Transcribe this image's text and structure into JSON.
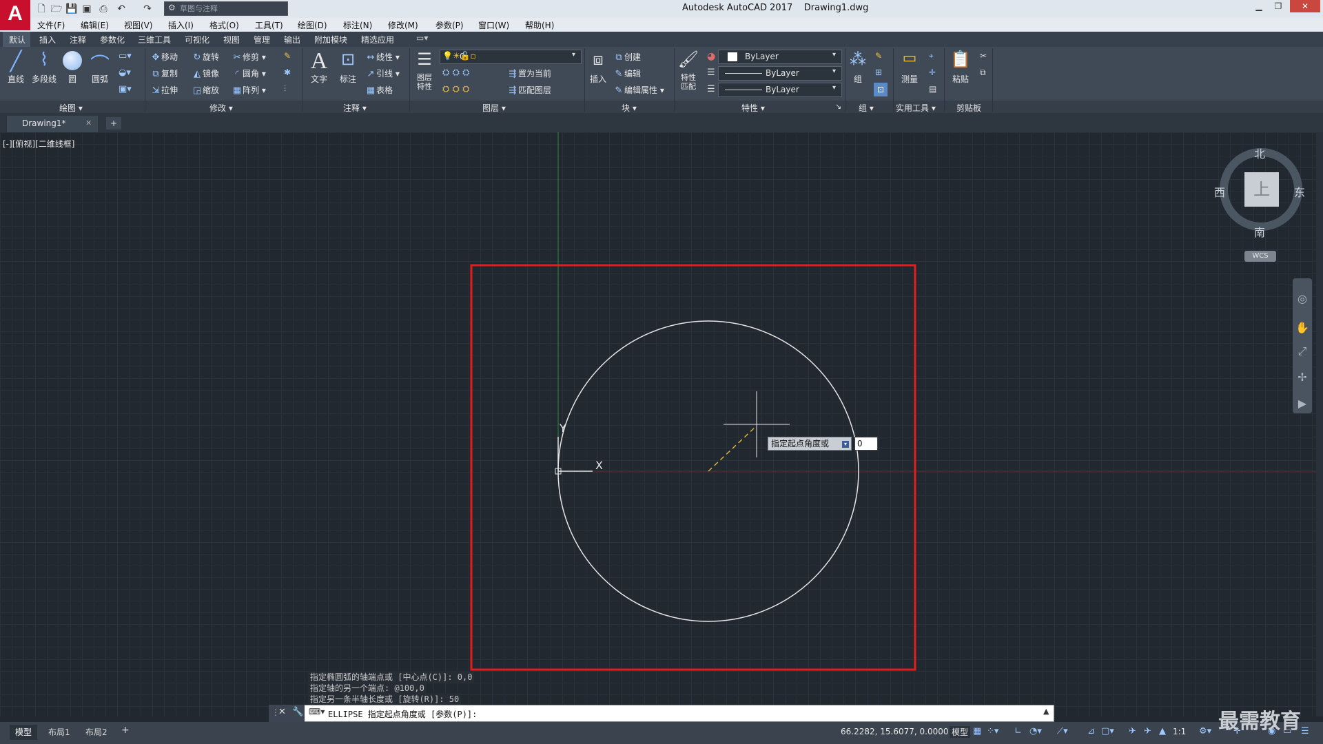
{
  "title_bar": {
    "app_name": "Autodesk AutoCAD 2017",
    "file_name": "Drawing1.dwg",
    "workspace": "草图与注释",
    "logo": "A"
  },
  "menu": [
    "文件(F)",
    "编辑(E)",
    "视图(V)",
    "插入(I)",
    "格式(O)",
    "工具(T)",
    "绘图(D)",
    "标注(N)",
    "修改(M)",
    "参数(P)",
    "窗口(W)",
    "帮助(H)"
  ],
  "ribbon_tabs": [
    "默认",
    "插入",
    "注释",
    "参数化",
    "三维工具",
    "可视化",
    "视图",
    "管理",
    "输出",
    "附加模块",
    "精选应用"
  ],
  "ribbon": {
    "draw": {
      "title": "绘图",
      "line": "直线",
      "polyline": "多段线",
      "circle": "圆",
      "arc": "圆弧"
    },
    "modify": {
      "title": "修改",
      "move": "移动",
      "rotate": "旋转",
      "trim": "修剪",
      "copy": "复制",
      "mirror": "镜像",
      "fillet": "圆角",
      "stretch": "拉伸",
      "scale": "缩放",
      "array": "阵列"
    },
    "annotation": {
      "title": "注释",
      "text": "文字",
      "dimension": "标注",
      "linear": "线性",
      "leader": "引线",
      "table": "表格"
    },
    "layers": {
      "title": "图层",
      "properties": "图层特性",
      "current_layer": "0",
      "set_current": "置为当前",
      "match_layer": "匹配图层"
    },
    "block": {
      "title": "块",
      "insert": "插入",
      "create": "创建",
      "edit": "编辑",
      "edit_attr": "编辑属性"
    },
    "properties": {
      "title": "特性",
      "match": "特性匹配",
      "color": "ByLayer",
      "linetype": "ByLayer",
      "lineweight": "ByLayer"
    },
    "groups": {
      "title": "组",
      "group": "组"
    },
    "utilities": {
      "title": "实用工具",
      "measure": "测量"
    },
    "clipboard": {
      "title": "剪贴板",
      "paste": "粘贴"
    }
  },
  "document_tab": "Drawing1*",
  "viewport_label": "[-][俯视][二维线框]",
  "viewcube": {
    "north": "北",
    "south": "南",
    "east": "东",
    "west": "西",
    "top": "上",
    "wcs": "WCS"
  },
  "axis_labels": {
    "y": "Y",
    "x": "X"
  },
  "tooltip": {
    "label": "指定起点角度或",
    "input_value": "0"
  },
  "command_history": [
    "指定椭圆弧的轴端点或 [中心点(C)]: 0,0",
    "指定轴的另一个端点: @100,0",
    "指定另一条半轴长度或 [旋转(R)]: 50"
  ],
  "command_prompt": "ELLIPSE 指定起点角度或 [参数(P)]:",
  "layout_tabs": [
    "模型",
    "布局1",
    "布局2"
  ],
  "status": {
    "coords": "66.2282, 15.6077, 0.0000",
    "mode": "模型",
    "scale": "1:1"
  },
  "watermark": "最需教育",
  "colors": {
    "accent": "#c8102e",
    "canvas": "#212830",
    "highlight_rect": "#e11d1d"
  }
}
